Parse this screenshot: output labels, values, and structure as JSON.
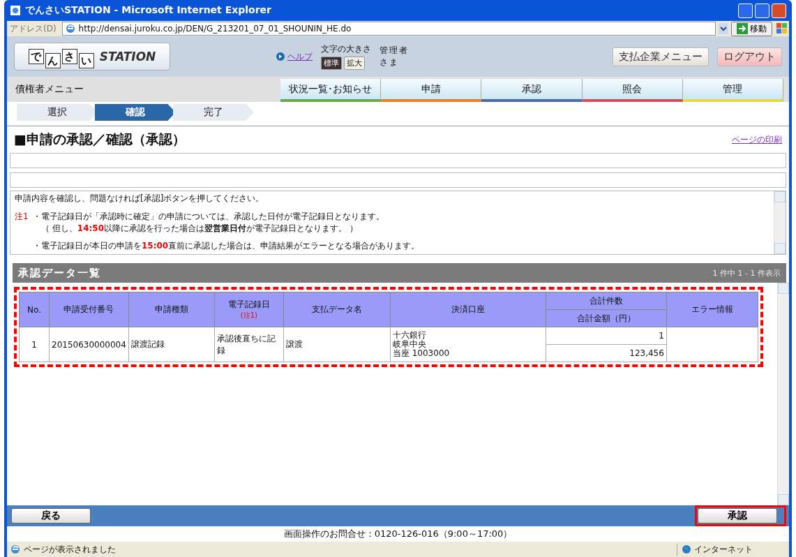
{
  "window": {
    "title": "でんさいSTATION - Microsoft Internet Explorer",
    "address_label": "アドレス(D)",
    "url": "http://densai.juroku.co.jp/DEN/G_213201_07_01_SHOUNIN_HE.do",
    "go_button": "移動"
  },
  "header": {
    "logo_chars": [
      "で",
      "ん",
      "さ",
      "い"
    ],
    "logo_word": "STATION",
    "help_link": "ヘルプ",
    "font_size_label": "文字の大きさ",
    "font_sizes": [
      {
        "label": "標準",
        "selected": true
      },
      {
        "label": "拡大",
        "selected": false
      }
    ],
    "user_role": "管理者",
    "honorific": "さま",
    "buttons": [
      {
        "label": "支払企業メニュー",
        "kind": "plain"
      },
      {
        "label": "ログアウト",
        "kind": "logout"
      }
    ]
  },
  "menu": {
    "title": "債権者メニュー",
    "tabs": [
      {
        "label": "状況一覧･お知らせ",
        "color": "#6aa84f"
      },
      {
        "label": "申請",
        "color": "#e6822a"
      },
      {
        "label": "承認",
        "color": "#4a6aa8"
      },
      {
        "label": "照会",
        "color": "#d0505a"
      },
      {
        "label": "管理",
        "color": "#e8d84a"
      }
    ]
  },
  "steps": [
    {
      "label": "選択",
      "selected": false
    },
    {
      "label": "確認",
      "selected": true
    },
    {
      "label": "完了",
      "selected": false
    }
  ],
  "page_title": "■申請の承認／確認（承認）",
  "print_link": "ページの印刷",
  "notes": {
    "intro": "申請内容を確認し、問題なければ[承認]ボタンを押してください。",
    "note_label": "注1",
    "lines": [
      [
        {
          "kind": "plain",
          "text": "・電子記録日が「承認時に確定」の申請については、承認した日付が電子記録日となります。"
        }
      ],
      [
        {
          "kind": "plain",
          "text": "（ 但し、"
        },
        {
          "kind": "red",
          "text": "14:50"
        },
        {
          "kind": "plain",
          "text": "以降に承認を行った場合は"
        },
        {
          "kind": "bold",
          "text": "翌営業日付"
        },
        {
          "kind": "plain",
          "text": "が電子記録日となります。 ）"
        }
      ],
      [
        {
          "kind": "plain",
          "text": "・電子記録日が本日の申請を"
        },
        {
          "kind": "red",
          "text": "15:00"
        },
        {
          "kind": "plain",
          "text": "直前に承認した場合は、申請結果がエラーとなる場合があります。"
        }
      ]
    ]
  },
  "list": {
    "title": "承認データ一覧",
    "count": "1 件中 1 - 1 件表示",
    "columns": {
      "no": "No.",
      "receipt_number": "申請受付番号",
      "type": "申請種類",
      "record_date": "電子記録日",
      "record_date_note": "(注1)",
      "payment_data_name": "支払データ名",
      "account": "決済口座",
      "total_count": "合計件数",
      "total_amount": "合計金額（円）",
      "error_info": "エラー情報"
    },
    "rows": [
      {
        "no": "1",
        "receipt_number": "20150630000004",
        "type": "譲渡記録",
        "record_date": "承認後直ちに記録",
        "payment_data_name": "譲渡",
        "account_lines": [
          "十六銀行",
          "岐阜中央",
          "当座 1003000"
        ],
        "total_count": "1",
        "total_amount": "123,456"
      }
    ]
  },
  "back_button": "戻る",
  "approve_button": "承認",
  "contact": "画面操作のお問合せ：0120-126-016（9:00～17:00）",
  "status_bar": {
    "message": "ページが表示されました",
    "zone": "インターネット"
  }
}
